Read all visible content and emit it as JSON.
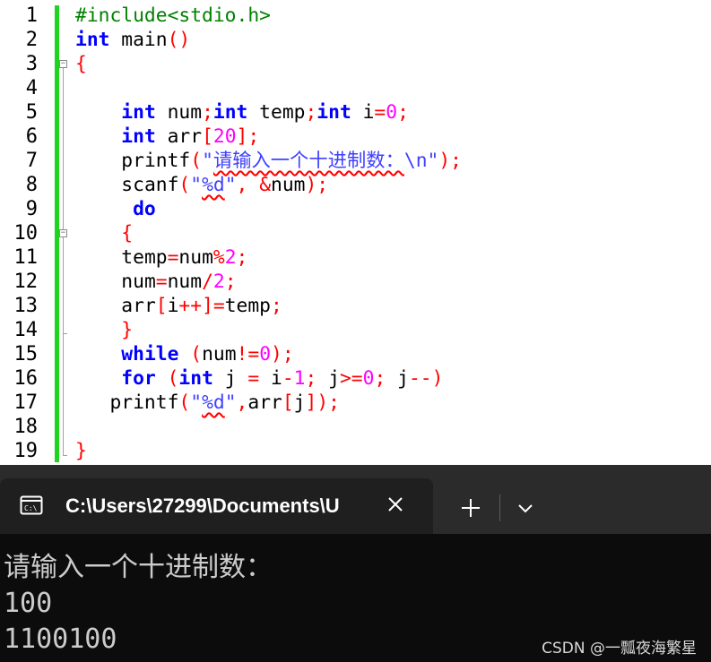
{
  "editor": {
    "line_numbers": [
      "1",
      "2",
      "3",
      "4",
      "5",
      "6",
      "7",
      "8",
      "9",
      "10",
      "11",
      "12",
      "13",
      "14",
      "15",
      "16",
      "17",
      "18",
      "19"
    ],
    "code": {
      "l1_include": "#include<stdio.h>",
      "l2_int": "int",
      "l2_main": " main",
      "l2_parens": "()",
      "l3_brace": "{",
      "l5_int1": "int",
      "l5_num": " num",
      "l5_semi1": ";",
      "l5_int2": "int",
      "l5_temp": " temp",
      "l5_semi2": ";",
      "l5_int3": "int",
      "l5_i": " i",
      "l5_eq": "=",
      "l5_zero": "0",
      "l5_semi3": ";",
      "l6_int": "int",
      "l6_arr": " arr",
      "l6_lb": "[",
      "l6_20": "20",
      "l6_rb": "];",
      "l7_printf": "printf",
      "l7_lp": "(",
      "l7_str_a": "\"",
      "l7_str_b": "请输入一个十进制数：",
      "l7_str_c": "\\n\"",
      "l7_rp": ");",
      "l8_scanf": "scanf",
      "l8_lp": "(",
      "l8_str_a": "\"",
      "l8_str_b": "%d",
      "l8_str_c": "\"",
      "l8_comma": ", &",
      "l8_num": "num",
      "l8_rp": ");",
      "l9_do": "do",
      "l10_brace": "{",
      "l11_temp": "temp",
      "l11_eq": "=",
      "l11_num": "num",
      "l11_mod": "%",
      "l11_2": "2",
      "l11_semi": ";",
      "l12_num": "num",
      "l12_eq": "=",
      "l12_num2": "num",
      "l12_div": "/",
      "l12_2": "2",
      "l12_semi": ";",
      "l13_arr": "arr",
      "l13_lb": "[",
      "l13_i": "i",
      "l13_inc": "++]=",
      "l13_temp": "temp",
      "l13_semi": ";",
      "l14_brace": "}",
      "l15_while": "while",
      "l15_lp": " (",
      "l15_num": "num",
      "l15_ne": "!=",
      "l15_0": "0",
      "l15_rp": ");",
      "l16_for": "for",
      "l16_lp": " (",
      "l16_int": "int",
      "l16_j": " j ",
      "l16_eq": "=",
      "l16_i": " i",
      "l16_minus": "-",
      "l16_1": "1",
      "l16_s1": "; ",
      "l16_j2": "j",
      "l16_ge": ">=",
      "l16_0": "0",
      "l16_s2": "; ",
      "l16_j3": "j",
      "l16_dec": "--)",
      "l17_printf": "printf",
      "l17_lp": "(",
      "l17_str_a": "\"",
      "l17_str_b": "%d",
      "l17_str_c": "\"",
      "l17_comma": ",",
      "l17_arr": "arr",
      "l17_lb": "[",
      "l17_j": "j",
      "l17_rb": "]);",
      "l19_brace": "}"
    },
    "colors": {
      "keyword": "#0000ff",
      "preprocessor": "#008000",
      "punctuation": "#ff0000",
      "number": "#ff00ff",
      "string": "#4040ff",
      "change_bar": "#1fd41f"
    }
  },
  "terminal": {
    "tab_icon": "terminal-icon",
    "tab_title": "C:\\Users\\27299\\Documents\\U",
    "close_icon": "close-icon",
    "new_tab_icon": "plus-icon",
    "dropdown_icon": "chevron-down-icon",
    "output_lines": [
      "请输入一个十进制数：",
      "100",
      "1100100"
    ],
    "watermark": "CSDN @一瓢夜海繁星",
    "colors": {
      "background": "#0c0c0c",
      "tabbar": "#2b2b2b",
      "active_tab": "#1f1f1f",
      "text": "#cccccc"
    }
  }
}
